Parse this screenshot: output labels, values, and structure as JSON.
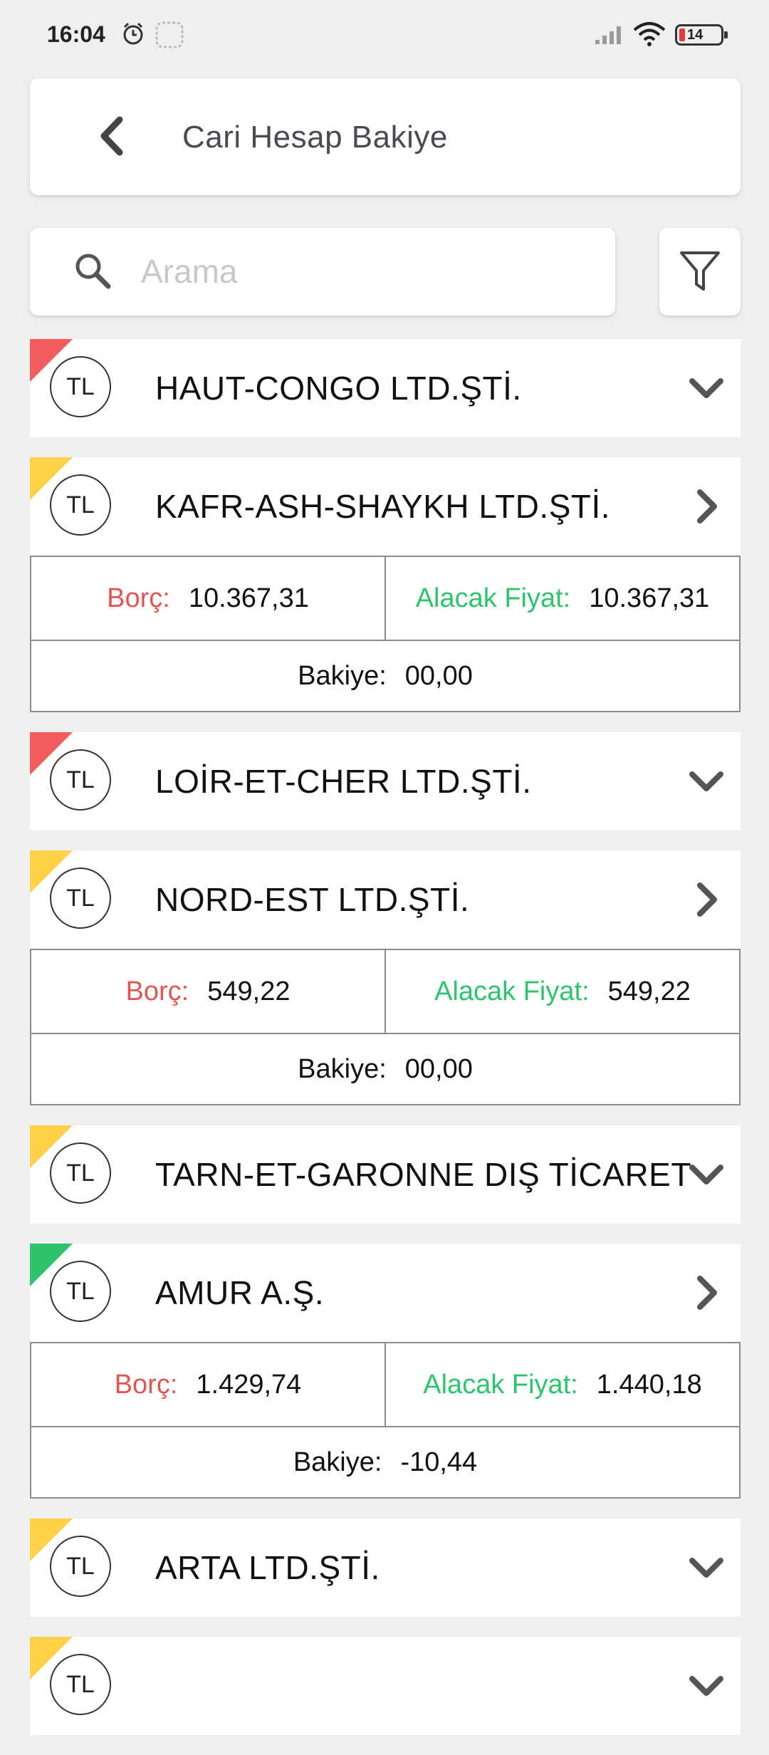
{
  "status_bar": {
    "time": "16:04",
    "battery": "14",
    "icons": [
      "alarm-icon",
      "app-notification-icon",
      "signal-icon",
      "wifi-icon",
      "battery-icon"
    ]
  },
  "header": {
    "title": "Cari Hesap Bakiye",
    "back_icon": "chevron-left-icon"
  },
  "search": {
    "placeholder": "Arama",
    "value": "",
    "icon": "search-icon",
    "filter_icon": "filter-icon"
  },
  "colors": {
    "red": "#f25c5c",
    "yellow": "#fdd249",
    "green": "#2ec46d",
    "borc_label": "#e25555",
    "alacak_label": "#2ec46d"
  },
  "labels": {
    "borc": "Borç:",
    "alacak": "Alacak Fiyat:",
    "bakiye": "Bakiye:"
  },
  "accounts": [
    {
      "currency": "TL",
      "name": "HAUT-CONGO LTD.ŞTİ.",
      "flag": "red",
      "expanded": false
    },
    {
      "currency": "TL",
      "name": "KAFR-ASH-SHAYKH LTD.ŞTİ.",
      "flag": "yellow",
      "expanded": true,
      "borc": "10.367,31",
      "alacak": "10.367,31",
      "bakiye": "00,00"
    },
    {
      "currency": "TL",
      "name": "LOİR-ET-CHER LTD.ŞTİ.",
      "flag": "red",
      "expanded": false
    },
    {
      "currency": "TL",
      "name": "NORD-EST LTD.ŞTİ.",
      "flag": "yellow",
      "expanded": true,
      "borc": "549,22",
      "alacak": "549,22",
      "bakiye": "00,00"
    },
    {
      "currency": "TL",
      "name": "TARN-ET-GARONNE DIŞ TİCARET",
      "flag": "yellow",
      "expanded": false
    },
    {
      "currency": "TL",
      "name": "AMUR A.Ş.",
      "flag": "green",
      "expanded": true,
      "borc": "1.429,74",
      "alacak": "1.440,18",
      "bakiye": "-10,44"
    },
    {
      "currency": "TL",
      "name": "ARTA LTD.ŞTİ.",
      "flag": "yellow",
      "expanded": false
    },
    {
      "currency": "TL",
      "name": "",
      "flag": "yellow",
      "expanded": false
    }
  ]
}
